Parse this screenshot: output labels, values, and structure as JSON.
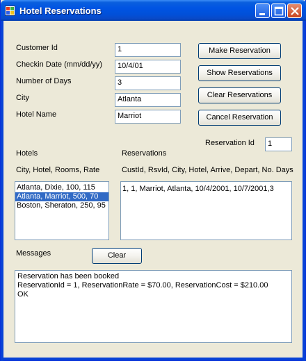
{
  "window": {
    "title": "Hotel Reservations",
    "icon": "app-window-icon",
    "controls": {
      "minimize": "minimize-icon",
      "maximize": "maximize-icon",
      "close": "close-icon"
    }
  },
  "form": {
    "customer_id": {
      "label": "Customer Id",
      "value": "1"
    },
    "checkin_date": {
      "label": "Checkin Date (mm/dd/yy)",
      "value": "10/4/01"
    },
    "number_of_days": {
      "label": "Number of Days",
      "value": "3"
    },
    "city": {
      "label": "City",
      "value": "Atlanta"
    },
    "hotel_name": {
      "label": "Hotel Name",
      "value": "Marriot"
    }
  },
  "buttons": {
    "make": "Make Reservation",
    "show": "Show Reservations",
    "clear_reservations": "Clear Reservations",
    "cancel": "Cancel Reservation",
    "clear_messages": "Clear"
  },
  "reservation_id": {
    "label": "Reservation Id",
    "value": "1"
  },
  "hotels": {
    "title": "Hotels",
    "header": "City, Hotel, Rooms, Rate",
    "items": [
      {
        "text": "Atlanta, Dixie, 100, 115",
        "selected": false
      },
      {
        "text": "Atlanta, Marriot, 500, 70",
        "selected": true
      },
      {
        "text": "Boston, Sheraton, 250, 95",
        "selected": false
      }
    ]
  },
  "reservations": {
    "title": "Reservations",
    "header": "CustId, RsvId, City, Hotel, Arrive, Depart,  No. Days",
    "items": [
      {
        "text": "1, 1, Marriot, Atlanta, 10/4/2001, 10/7/2001,3"
      }
    ]
  },
  "messages": {
    "label": "Messages",
    "lines": [
      "Reservation has been booked",
      "ReservationId = 1, ReservationRate = $70.00, ReservationCost = $210.00",
      "OK"
    ]
  },
  "colors": {
    "title_bar": "#0054e3",
    "selection": "#316ac5",
    "window_bg": "#ece9d8"
  }
}
